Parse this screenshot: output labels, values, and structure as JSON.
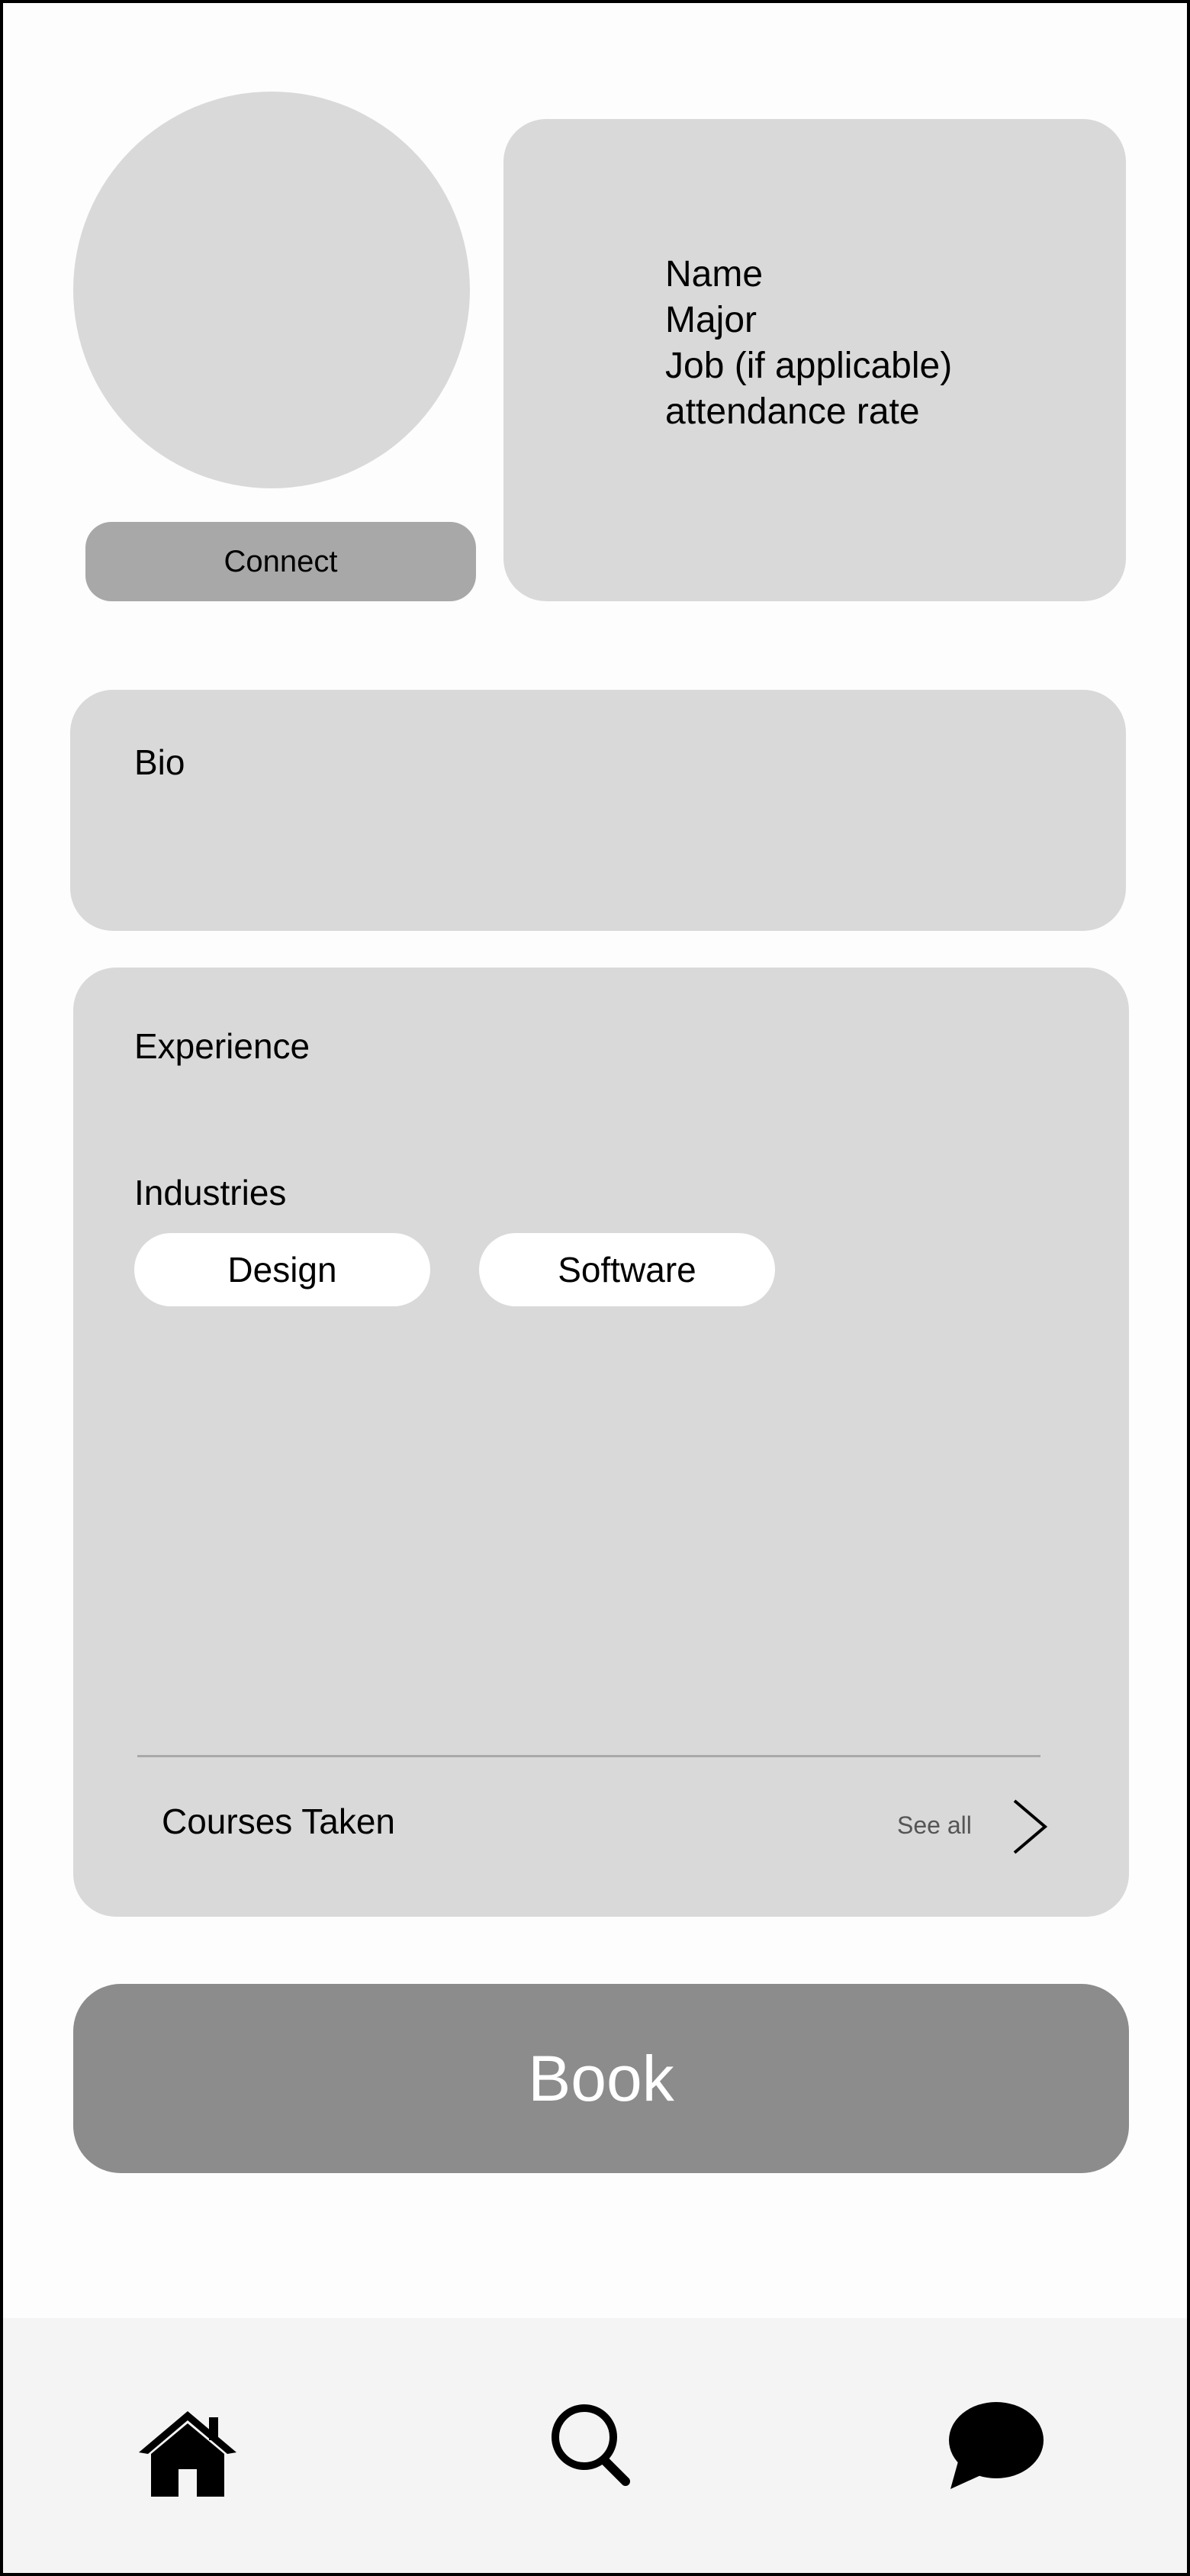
{
  "profile": {
    "connect_label": "Connect",
    "info": {
      "name": "Name",
      "major": "Major",
      "job": "Job (if applicable)",
      "attendance": "attendance rate"
    }
  },
  "bio": {
    "title": "Bio"
  },
  "experience": {
    "title": "Experience",
    "industries_title": "Industries",
    "industries": [
      "Design",
      "Software"
    ],
    "courses_label": "Courses Taken",
    "see_all_label": "See all"
  },
  "book_label": "Book",
  "tabbar": {
    "items": [
      {
        "icon": "home-icon"
      },
      {
        "icon": "search-icon"
      },
      {
        "icon": "chat-bubble-icon"
      }
    ]
  },
  "colors": {
    "card": "#d9d9d9",
    "connect_button": "#a8a8a8",
    "book_button": "#8c8c8c",
    "tabbar": "#f4f4f4"
  }
}
